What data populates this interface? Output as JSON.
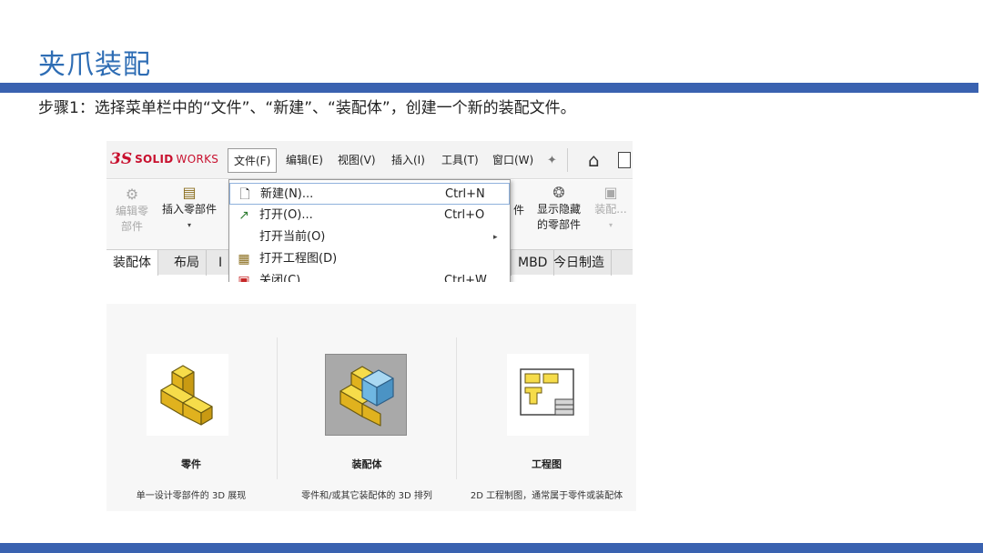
{
  "slide": {
    "title": "夹爪装配",
    "step": "步骤1：选择菜单栏中的“文件”、“新建”、“装配体”，创建一个新的装配文件。",
    "accent_color": "#3a62b0",
    "title_color": "#2e6db4"
  },
  "solidworks": {
    "logo": {
      "ds": "3S",
      "solid": "SOLID",
      "works": "WORKS"
    },
    "menu": [
      {
        "label": "文件(F)",
        "active": true
      },
      {
        "label": "编辑(E)"
      },
      {
        "label": "视图(V)"
      },
      {
        "label": "插入(I)"
      },
      {
        "label": "工具(T)"
      },
      {
        "label": "窗口(W)"
      }
    ],
    "icons": {
      "pin": "pin-icon",
      "home": "home-icon",
      "document": "document-icon"
    },
    "ribbon": {
      "edit_part": {
        "line1": "编辑零",
        "line2": "部件",
        "disabled": true
      },
      "insert_part": {
        "label": "插入零部件"
      },
      "partial_left": {
        "label": "件"
      },
      "show_hidden": {
        "line1": "显示隐藏",
        "line2": "的零部件"
      },
      "assembly": {
        "label": "装配...",
        "disabled": true
      }
    },
    "tabs": [
      "装配体",
      "布局",
      "I",
      "MBD",
      "今日制造"
    ],
    "file_menu": [
      {
        "icon": "new-document-icon",
        "label": "新建(N)...",
        "shortcut": "Ctrl+N",
        "highlighted": true
      },
      {
        "icon": "open-folder-icon",
        "label": "打开(O)...",
        "shortcut": "Ctrl+O"
      },
      {
        "icon": "",
        "label": "打开当前(O)",
        "submenu": true
      },
      {
        "icon": "drawing-icon",
        "label": "打开工程图(D)"
      },
      {
        "icon": "close-icon",
        "label": "关闭(C)",
        "shortcut": "Ctrl+W"
      }
    ]
  },
  "new_document": {
    "cards": [
      {
        "label": "零件",
        "description": "单一设计零部件的 3D 展现",
        "icon": "part-icon",
        "selected": false
      },
      {
        "label": "装配体",
        "description": "零件和/或其它装配体的 3D 排列",
        "icon": "assembly-icon",
        "selected": true
      },
      {
        "label": "工程图",
        "description": "2D 工程制图，通常属于零件或装配体",
        "icon": "drawing-sheet-icon",
        "selected": false
      }
    ]
  }
}
